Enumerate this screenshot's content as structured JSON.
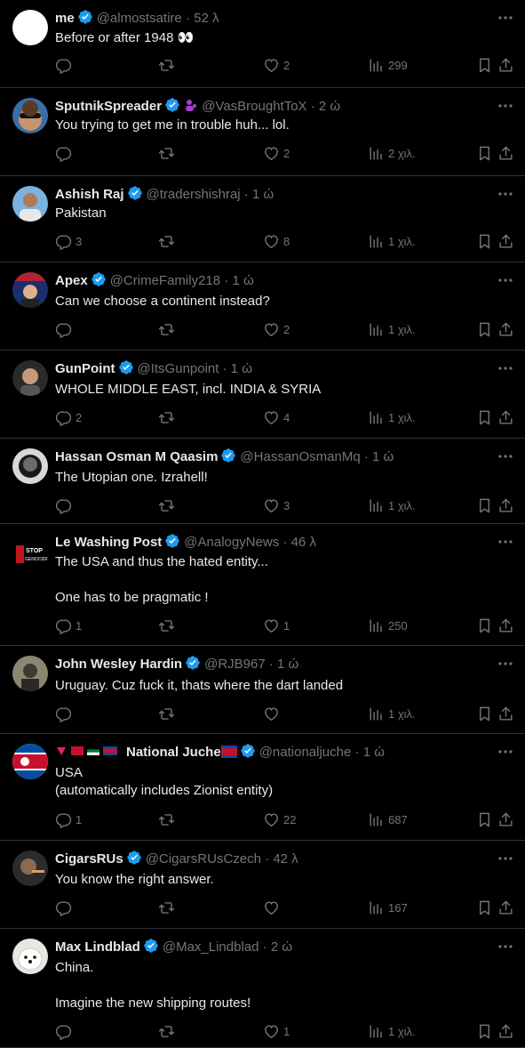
{
  "colors": {
    "background": "#000000",
    "text": "#e7e9ea",
    "muted": "#71767b",
    "border": "#2f3336",
    "verified": "#1d9bf0"
  },
  "tweets": [
    {
      "name": "me",
      "handle": "@almostsatire",
      "time": "52 λ",
      "text": "Before or after 1948 👀",
      "reply": "",
      "retweet": "",
      "like": "2",
      "views": "299"
    },
    {
      "name": "SputnikSpreader",
      "handle": "@VasBroughtToX",
      "time": "2 ώ",
      "text": "You trying to get me in trouble huh... lol.",
      "reply": "",
      "retweet": "",
      "like": "2",
      "views": "2 χιλ."
    },
    {
      "name": "Ashish Raj",
      "handle": "@tradershishraj",
      "time": "1 ώ",
      "text": "Pakistan",
      "reply": "3",
      "retweet": "",
      "like": "8",
      "views": "1 χιλ."
    },
    {
      "name": "Apex",
      "handle": "@CrimeFamily218",
      "time": "1 ώ",
      "text": "Can we choose a continent instead?",
      "reply": "",
      "retweet": "",
      "like": "2",
      "views": "1 χιλ."
    },
    {
      "name": "GunPoint",
      "handle": "@ItsGunpoint",
      "time": "1 ώ",
      "text": "WHOLE MIDDLE EAST, incl. INDIA & SYRIA",
      "reply": "2",
      "retweet": "",
      "like": "4",
      "views": "1 χιλ."
    },
    {
      "name": "Hassan Osman M Qaasim",
      "handle": "@HassanOsmanMq",
      "time": "1 ώ",
      "text": "The Utopian one. Izrahell!",
      "reply": "",
      "retweet": "",
      "like": "3",
      "views": "1 χιλ."
    },
    {
      "name": "Le Washing Post",
      "handle": "@AnalogyNews",
      "time": "46 λ",
      "text": "The USA and thus the hated entity...\n\nOne has to be pragmatic !",
      "reply": "1",
      "retweet": "",
      "like": "1",
      "views": "250"
    },
    {
      "name": "John Wesley Hardin",
      "handle": "@RJB967",
      "time": "1 ώ",
      "text": "Uruguay. Cuz fuck it, thats where the dart landed",
      "reply": "",
      "retweet": "",
      "like": "",
      "views": "1 χιλ."
    },
    {
      "name": "National Juche",
      "handle": "@nationaljuche",
      "time": "1 ώ",
      "text": "USA\n(automatically includes Zionist entity)",
      "reply": "1",
      "retweet": "",
      "like": "22",
      "views": "687"
    },
    {
      "name": "CigarsRUs",
      "handle": "@CigarsRUsCzech",
      "time": "42 λ",
      "text": "You know the right answer.",
      "reply": "",
      "retweet": "",
      "like": "",
      "views": "167"
    },
    {
      "name": "Max Lindblad",
      "handle": "@Max_Lindblad",
      "time": "2 ώ",
      "text": "China.\n\nImagine the new shipping routes!",
      "reply": "",
      "retweet": "",
      "like": "1",
      "views": "1 χιλ."
    }
  ]
}
